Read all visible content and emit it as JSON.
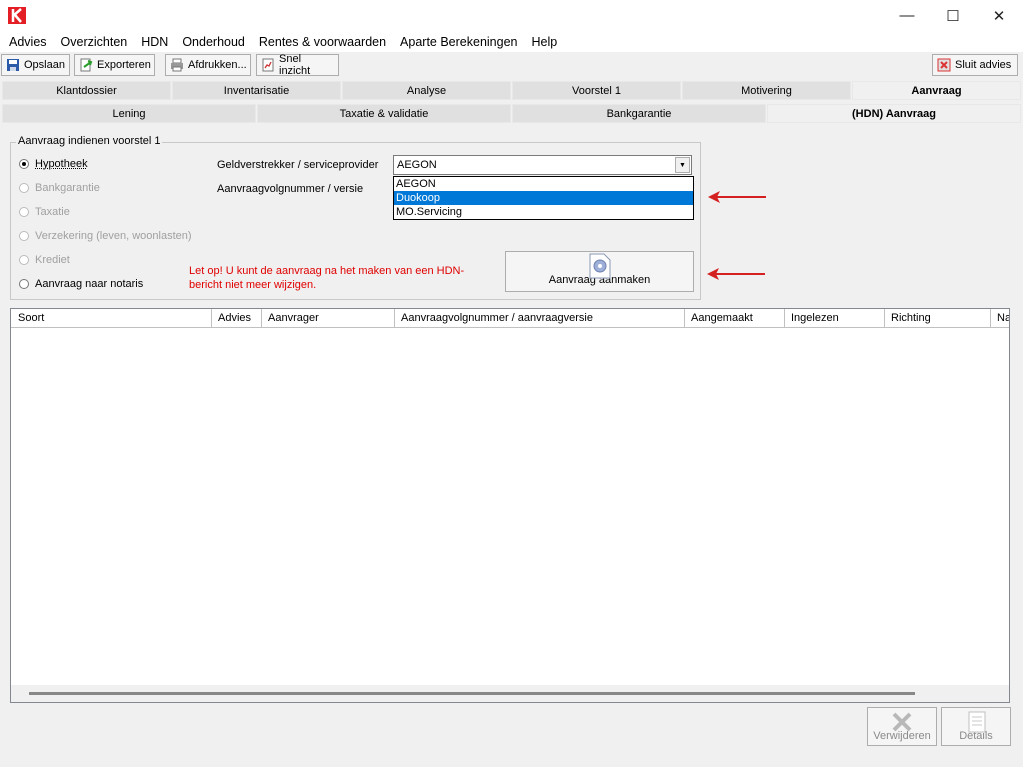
{
  "window": {
    "minimize_icon": "minimize-icon",
    "maximize_icon": "maximize-icon",
    "close_icon": "close-icon",
    "logo_color": "#e31e24"
  },
  "menu": [
    "Advies",
    "Overzichten",
    "HDN",
    "Onderhoud",
    "Rentes & voorwaarden",
    "Aparte Berekeningen",
    "Help"
  ],
  "toolbar": {
    "save": "Opslaan",
    "export": "Exporteren",
    "print": "Afdrukken...",
    "quick": "Snel inzicht",
    "close_advice": "Sluit advies"
  },
  "tabs_main": [
    "Klantdossier",
    "Inventarisatie",
    "Analyse",
    "Voorstel 1",
    "Motivering",
    "Aanvraag"
  ],
  "tabs_sub": [
    "Lening",
    "Taxatie & validatie",
    "Bankgarantie",
    "(HDN) Aanvraag"
  ],
  "group": {
    "legend": "Aanvraag indienen voorstel 1",
    "radios": [
      {
        "label": "Hypotheek",
        "checked": true,
        "enabled": true
      },
      {
        "label": "Bankgarantie",
        "checked": false,
        "enabled": false
      },
      {
        "label": "Taxatie",
        "checked": false,
        "enabled": false
      },
      {
        "label": "Verzekering (leven, woonlasten)",
        "checked": false,
        "enabled": false
      },
      {
        "label": "Krediet",
        "checked": false,
        "enabled": false
      },
      {
        "label": "Aanvraag naar notaris",
        "checked": false,
        "enabled": true
      }
    ],
    "lender_label": "Geldverstrekker / serviceprovider",
    "version_label": "Aanvraagvolgnummer / versie",
    "combo_value": "AEGON",
    "dropdown_options": [
      "AEGON",
      "Duokoop",
      "MO.Servicing"
    ],
    "dropdown_selected": "Duokoop",
    "warning": "Let op! U kunt de aanvraag na het maken van een HDN-bericht niet meer wijzigen.",
    "create_button": "Aanvraag aanmaken",
    "arrow_color": "#d42020"
  },
  "grid": {
    "columns": [
      "Soort",
      "Advies",
      "Aanvrager",
      "Aanvraagvolgnummer / aanvraagversie",
      "Aangemaakt",
      "Ingelezen",
      "Richting",
      "Na"
    ]
  },
  "buttons": {
    "delete": "Verwijderen",
    "details": "Details"
  }
}
